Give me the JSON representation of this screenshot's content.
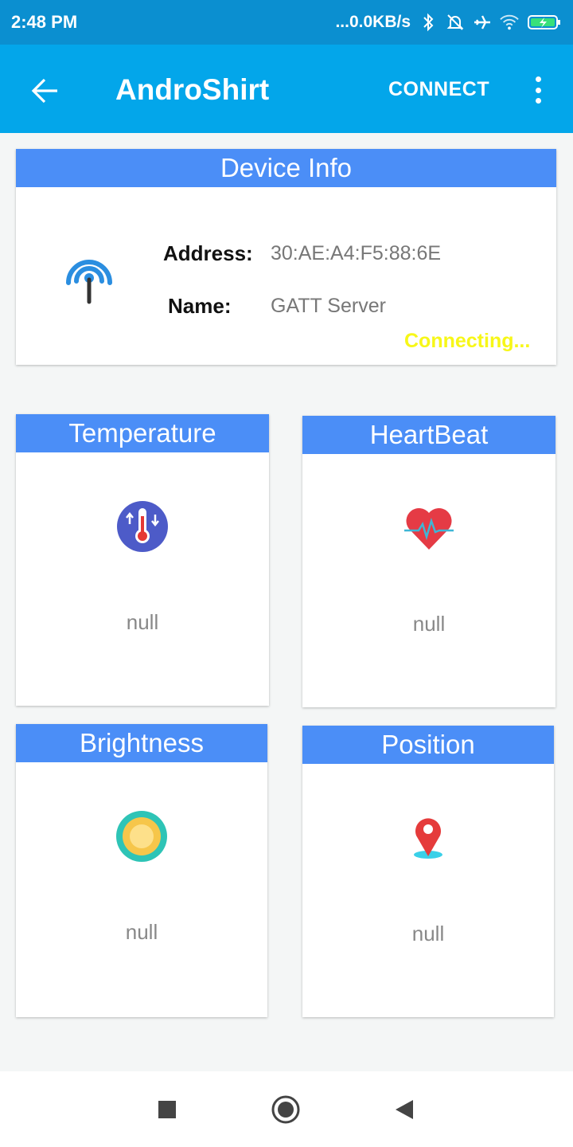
{
  "status_bar": {
    "time": "2:48 PM",
    "net_speed": "...0.0KB/s",
    "icons": [
      "bluetooth-icon",
      "mute-bell-icon",
      "airplane-icon",
      "wifi-icon",
      "battery-charging-icon"
    ]
  },
  "app_bar": {
    "title": "AndroShirt",
    "connect_label": "CONNECT",
    "back_icon": "arrow-left-icon",
    "menu_icon": "more-vert-icon"
  },
  "device_info": {
    "header": "Device Info",
    "address_label": "Address:",
    "address_value": "30:AE:A4:F5:88:6E",
    "name_label": "Name:",
    "name_value": "GATT Server",
    "status": "Connecting...",
    "status_color": "#f7f718",
    "icon": "signal-tower-icon"
  },
  "sensors": [
    {
      "title": "Temperature",
      "value": "null",
      "icon": "thermometer-icon"
    },
    {
      "title": "HeartBeat",
      "value": "null",
      "icon": "heart-pulse-icon"
    },
    {
      "title": "Brightness",
      "value": "null",
      "icon": "sun-icon"
    },
    {
      "title": "Position",
      "value": "null",
      "icon": "location-pin-icon"
    }
  ],
  "nav_bar": {
    "icons": [
      "recents-square-icon",
      "home-circle-icon",
      "back-triangle-icon"
    ]
  },
  "colors": {
    "status_bar": "#0b8fd0",
    "app_bar": "#03a6ea",
    "card_header": "#4b8ef7",
    "background": "#f4f6f6"
  }
}
